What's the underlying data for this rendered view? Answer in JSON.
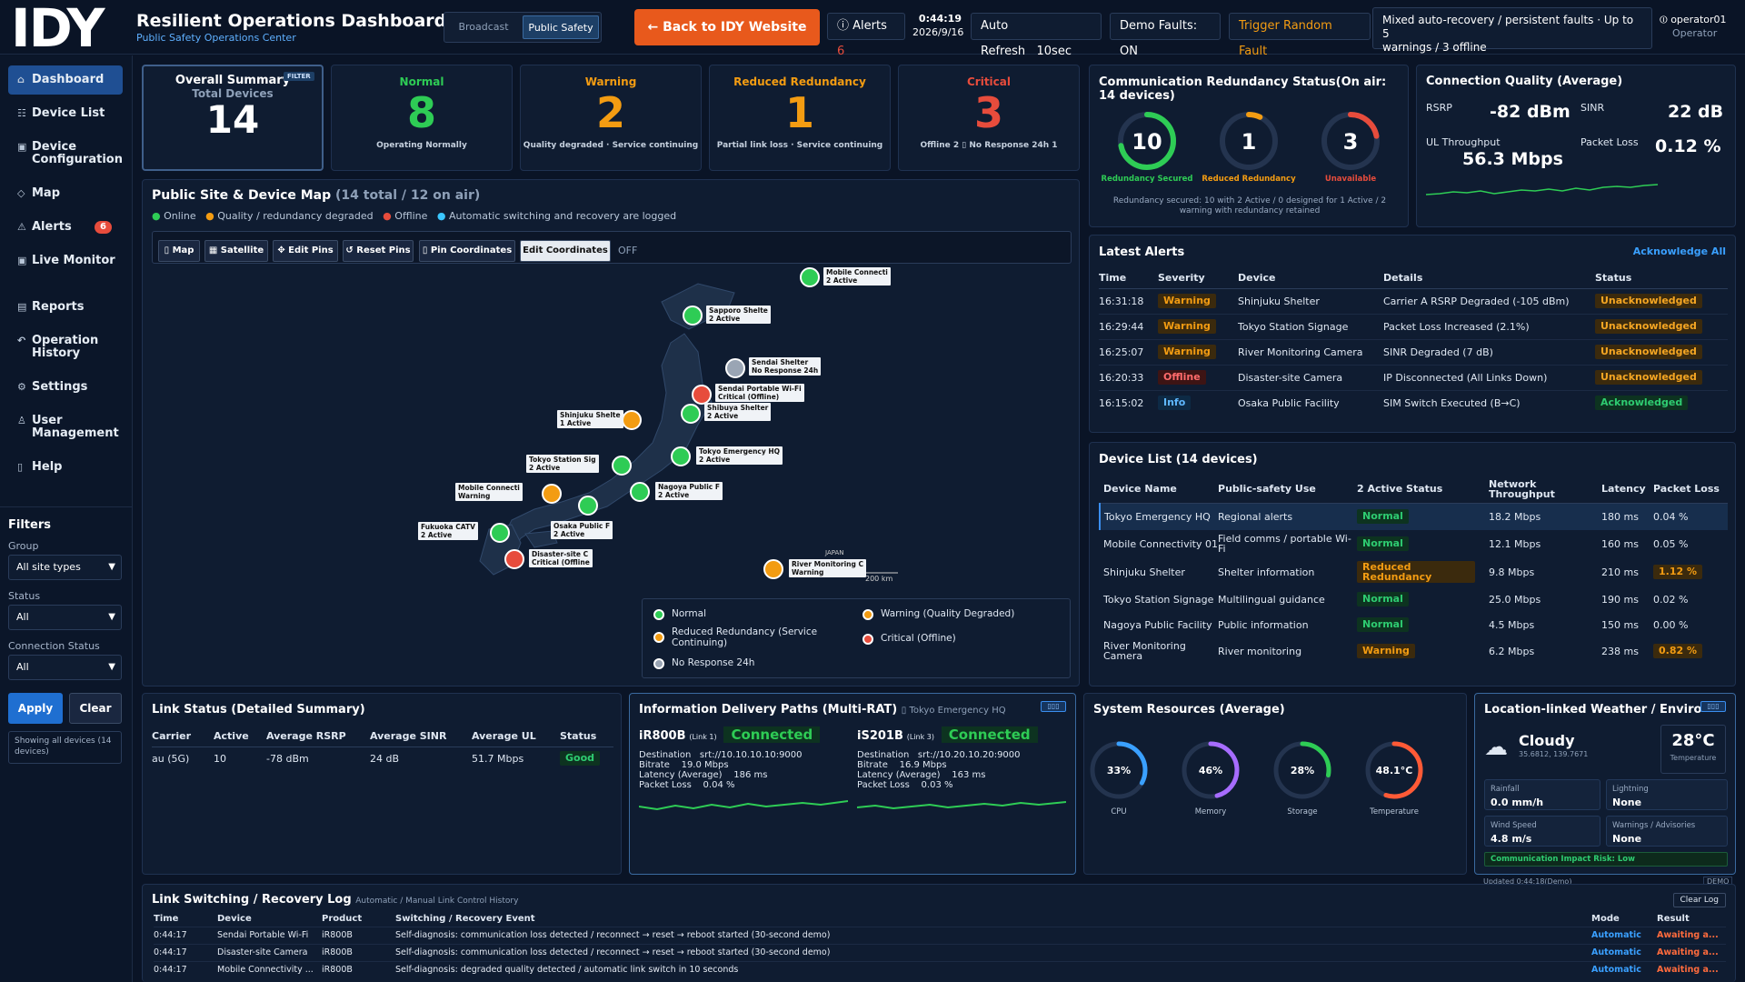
{
  "header": {
    "logo": "IDY",
    "title": "Resilient Operations Dashboard",
    "subtitle": "Public Safety Operations Center",
    "mode_broadcast": "Broadcast",
    "mode_public": "Public Safety",
    "back_btn": "← Back to IDY Website",
    "alerts_label": "Alerts",
    "alerts_count": "6",
    "time": "0:44:19",
    "date": "2026/9/16",
    "auto_refresh": "Auto Refresh",
    "refresh_interval": "10sec",
    "demo_faults": "Demo Faults: ON",
    "trigger": "Trigger Random Fault",
    "info_line1": "Mixed auto-recovery / persistent faults · Up to 5",
    "info_line2": "warnings / 3 offline",
    "user": "operator01",
    "role": "Operator"
  },
  "sidebar": {
    "items": [
      {
        "icon": "⌂",
        "label": "Dashboard"
      },
      {
        "icon": "☷",
        "label": "Device List"
      },
      {
        "icon": "▣",
        "label": "Device Configuration"
      },
      {
        "icon": "◇",
        "label": "Map"
      },
      {
        "icon": "⚠",
        "label": "Alerts",
        "badge": "6"
      },
      {
        "icon": "▣",
        "label": "Live Monitor"
      },
      {
        "icon": "▤",
        "label": "Reports"
      },
      {
        "icon": "↶",
        "label": "Operation History"
      },
      {
        "icon": "⚙",
        "label": "Settings"
      },
      {
        "icon": "♙",
        "label": "User Management"
      },
      {
        "icon": "▯",
        "label": "Help"
      }
    ],
    "filters_title": "Filters",
    "group_label": "Group",
    "group_value": "All site types",
    "status_label": "Status",
    "status_value": "All",
    "conn_label": "Connection Status",
    "conn_value": "All",
    "apply": "Apply",
    "clear": "Clear",
    "showing": "Showing all devices (14 devices)"
  },
  "summary": {
    "overall_title": "Overall Summary",
    "filter_tag": "FILTER",
    "total_label": "Total Devices",
    "total": "14",
    "cards": [
      {
        "title": "Normal",
        "num": "8",
        "sub": "Operating Normally",
        "color": "#2ecc55"
      },
      {
        "title": "Warning",
        "num": "2",
        "sub": "Quality degraded · Service continuing",
        "color": "#f39c12"
      },
      {
        "title": "Reduced Redundancy",
        "num": "1",
        "sub": "Partial link loss · Service continuing",
        "color": "#f39c12"
      },
      {
        "title": "Critical",
        "num": "3",
        "sub": "Offline 2 ▯ No Response 24h 1",
        "color": "#e74c3c"
      }
    ]
  },
  "redundancy": {
    "title": "Communication Redundancy Status(On air: 14 devices)",
    "gauges": [
      {
        "num": "10",
        "label": "Redundancy Secured",
        "color": "#2ecc55",
        "frac": 0.72
      },
      {
        "num": "1",
        "label": "Reduced Redundancy",
        "color": "#f39c12",
        "frac": 0.07
      },
      {
        "num": "3",
        "label": "Unavailable",
        "color": "#e74c3c",
        "frac": 0.22
      }
    ],
    "note": "Redundancy secured: 10 with 2 Active / 0 designed for 1 Active / 2 warning with redundancy retained"
  },
  "quality": {
    "title": "Connection Quality (Average)",
    "rsrp_label": "RSRP",
    "rsrp": "-82 dBm",
    "sinr_label": "SINR",
    "sinr": "22 dB",
    "ul_label": "UL Throughput",
    "ul": "56.3 Mbps",
    "pl_label": "Packet Loss",
    "pl": "0.12 %"
  },
  "map": {
    "title": "Public Site & Device Map",
    "count": "(14 total / 12 on air)",
    "legend_top": [
      "Online",
      "Quality / redundancy degraded",
      "Offline",
      "Automatic switching and recovery are logged"
    ],
    "buttons": [
      "▯ Map",
      "▦ Satellite",
      "✥ Edit Pins",
      "↺ Reset Pins",
      "▯ Pin Coordinates",
      "Edit Coordinates"
    ],
    "off": "OFF",
    "scale": "200 km",
    "japan": "JAPAN",
    "pins": [
      {
        "label": "Mobile Connecti\n2 Active"
      },
      {
        "label": "Sapporo Shelte\n2 Active"
      },
      {
        "label": "Sendai Shelter\nNo Response 24h"
      },
      {
        "label": "Sendai Portable Wi-Fi\nCritical (Offline)"
      },
      {
        "label": "Shibuya Shelter\n2 Active"
      },
      {
        "label": "Shinjuku Shelte\n1 Active"
      },
      {
        "label": "Tokyo Emergency HQ\n2 Active"
      },
      {
        "label": "Tokyo Station Sig\n2 Active"
      },
      {
        "label": "Mobile Connecti\nWarning"
      },
      {
        "label": "Nagoya Public F\n2 Active"
      },
      {
        "label": "Osaka Public F\n2 Active"
      },
      {
        "label": "Fukuoka CATV\n2 Active"
      },
      {
        "label": "Disaster-site C\nCritical (Offline"
      },
      {
        "label": "River Monitoring C\nWarning"
      }
    ],
    "legend": [
      "Normal",
      "Warning (Quality Degraded)",
      "Reduced Redundancy (Service Continuing)",
      "Critical (Offline)",
      "No Response 24h"
    ]
  },
  "alerts": {
    "title": "Latest Alerts",
    "ack_all": "Acknowledge All",
    "headers": [
      "Time",
      "Severity",
      "Device",
      "Details",
      "Status"
    ],
    "rows": [
      [
        "16:31:18",
        "Warning",
        "Shinjuku Shelter",
        "Carrier A RSRP Degraded (-105 dBm)",
        "Unacknowledged"
      ],
      [
        "16:29:44",
        "Warning",
        "Tokyo Station Signage",
        "Packet Loss Increased (2.1%)",
        "Unacknowledged"
      ],
      [
        "16:25:07",
        "Warning",
        "River Monitoring Camera",
        "SINR Degraded (7 dB)",
        "Unacknowledged"
      ],
      [
        "16:20:33",
        "Offline",
        "Disaster-site Camera",
        "IP Disconnected (All Links Down)",
        "Unacknowledged"
      ],
      [
        "16:15:02",
        "Info",
        "Osaka Public Facility",
        "SIM Switch Executed (B→C)",
        "Acknowledged"
      ]
    ]
  },
  "devices": {
    "title": "Device List (14 devices)",
    "headers": [
      "Device Name",
      "Public-safety Use",
      "2 Active Status",
      "Network Throughput",
      "Latency",
      "Packet Loss"
    ],
    "rows": [
      [
        "Tokyo Emergency HQ",
        "Regional alerts",
        "Normal",
        "18.2 Mbps",
        "180 ms",
        "0.04 %"
      ],
      [
        "Mobile Connectivity 01",
        "Field comms / portable Wi-Fi",
        "Normal",
        "12.1 Mbps",
        "160 ms",
        "0.05 %"
      ],
      [
        "Shinjuku Shelter",
        "Shelter information",
        "Reduced Redundancy",
        "9.8 Mbps",
        "210 ms",
        "1.12 %"
      ],
      [
        "Tokyo Station Signage",
        "Multilingual guidance",
        "Normal",
        "25.0 Mbps",
        "190 ms",
        "0.02 %"
      ],
      [
        "Nagoya Public Facility",
        "Public information",
        "Normal",
        "4.5 Mbps",
        "150 ms",
        "0.00 %"
      ],
      [
        "River Monitoring Camera",
        "River monitoring",
        "Warning",
        "6.2 Mbps",
        "238 ms",
        "0.82 %"
      ]
    ]
  },
  "link": {
    "title": "Link Status (Detailed Summary)",
    "headers": [
      "Carrier",
      "Active",
      "Average RSRP",
      "Average SINR",
      "Average UL",
      "Status"
    ],
    "row": [
      "au (5G)",
      "10",
      "-78 dBm",
      "24 dB",
      "51.7 Mbps",
      "Good"
    ]
  },
  "paths": {
    "title": "Information Delivery Paths (Multi-RAT)",
    "device": "▯ Tokyo Emergency HQ",
    "links": [
      {
        "name": "iR800B",
        "tag": "(Link 1)",
        "state": "Connected",
        "dest": "Destination   srt://10.10.10.10:9000",
        "bitrate": "Bitrate    19.0 Mbps",
        "latency": "Latency (Average)    186 ms",
        "loss": "Packet Loss    0.04 %"
      },
      {
        "name": "iS201B",
        "tag": "(Link 3)",
        "state": "Connected",
        "dest": "Destination   srt://10.20.10.20:9000",
        "bitrate": "Bitrate    16.9 Mbps",
        "latency": "Latency (Average)    163 ms",
        "loss": "Packet Loss    0.03 %"
      }
    ]
  },
  "resources": {
    "title": "System Resources (Average)",
    "gauges": [
      {
        "val": "33%",
        "label": "CPU",
        "frac": 0.33,
        "color": "#3aa0ff"
      },
      {
        "val": "46%",
        "label": "Memory",
        "frac": 0.46,
        "color": "#a66cff"
      },
      {
        "val": "28%",
        "label": "Storage",
        "frac": 0.28,
        "color": "#2ecc55"
      },
      {
        "val": "48.1°C",
        "label": "Temperature",
        "frac": 0.55,
        "color": "#ff5a36"
      }
    ]
  },
  "weather": {
    "title": "Location-linked Weather / Environment",
    "cond": "Cloudy",
    "coords": "35.6812, 139.7671",
    "temp": "28°C",
    "temp_label": "Temperature",
    "boxes": [
      [
        "Rainfall",
        "0.0 mm/h"
      ],
      [
        "Lightning",
        "None"
      ],
      [
        "Wind Speed",
        "4.8 m/s"
      ],
      [
        "Warnings / Advisories",
        "None"
      ]
    ],
    "risk": "Communication Impact Risk: Low",
    "updated": "Updated 0:44:18(Demo)",
    "demo": "DEMO"
  },
  "log": {
    "title": "Link Switching / Recovery Log",
    "subtitle": "Automatic / Manual Link Control History",
    "clear": "Clear Log",
    "headers": [
      "Time",
      "Device",
      "Product",
      "Switching / Recovery Event",
      "Mode",
      "Result"
    ],
    "rows": [
      [
        "0:44:17",
        "Sendai Portable Wi-Fi",
        "iR800B",
        "Self-diagnosis: communication loss detected / reconnect → reset → reboot started (30-second demo)",
        "Automatic",
        "Awaiting a..."
      ],
      [
        "0:44:17",
        "Disaster-site Camera",
        "iR800B",
        "Self-diagnosis: communication loss detected / reconnect → reset → reboot started (30-second demo)",
        "Automatic",
        "Awaiting a..."
      ],
      [
        "0:44:17",
        "Mobile Connectivity ...",
        "iR800B",
        "Self-diagnosis: degraded quality detected / automatic link switch in 10 seconds",
        "Automatic",
        "Awaiting a..."
      ]
    ]
  }
}
